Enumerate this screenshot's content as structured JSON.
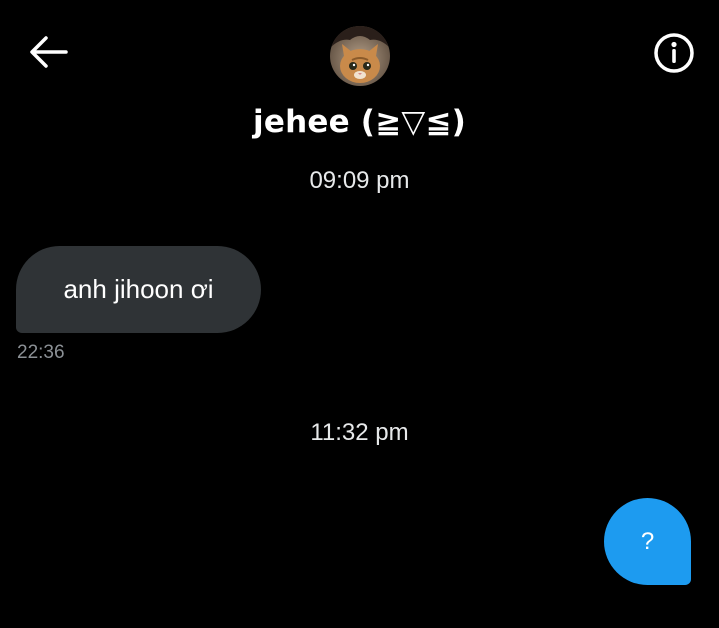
{
  "header": {
    "back_icon": "arrow-left-icon",
    "info_icon": "info-circle-icon",
    "display_name": "jehee (≧▽≦)"
  },
  "conversation": {
    "dividers": [
      "09:09 pm",
      "11:32 pm"
    ],
    "messages": [
      {
        "direction": "received",
        "text": "anh jihoon ơi",
        "time": "22:36"
      },
      {
        "direction": "sent",
        "text": "?"
      }
    ]
  },
  "colors": {
    "background": "#000000",
    "received_bubble": "#2f3336",
    "sent_bubble": "#1d9bf0",
    "muted_text": "#8b9095"
  }
}
